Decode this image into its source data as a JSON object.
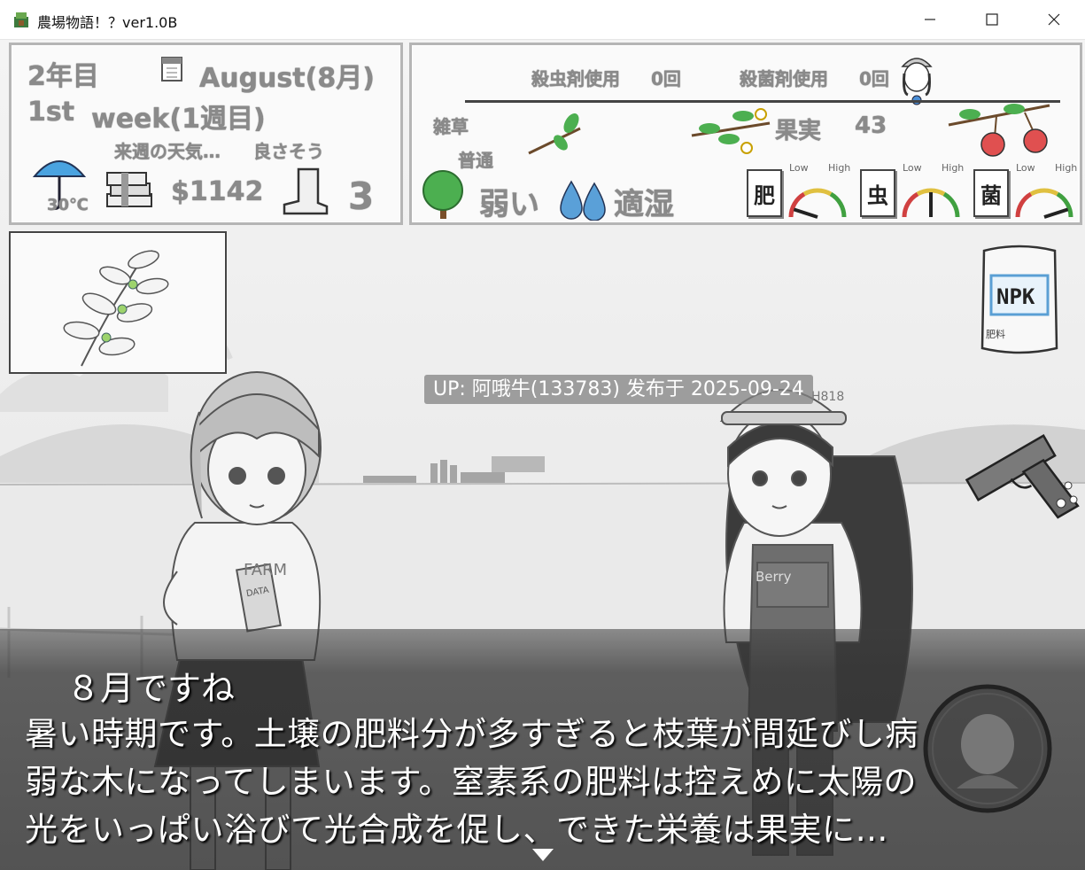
{
  "window": {
    "title": "農場物語！？ver1.0B",
    "minimize_glyph": "—",
    "maximize_glyph": "☐",
    "close_glyph": "✕"
  },
  "hud_left": {
    "year": "2年目",
    "month": "August(8月)",
    "week_ordinal": "1st",
    "week_label": "week(1週目)",
    "forecast_label": "来週の天気…",
    "forecast_value": "良さそう",
    "temperature": "30℃",
    "money": "$1142",
    "boots_count": "3"
  },
  "hud_right": {
    "insecticide_label": "殺虫剤使用",
    "insecticide_count": "0回",
    "fungicide_label": "殺菌剤使用",
    "fungicide_count": "0回",
    "weeds_label": "雑草",
    "weeds_value": "普通",
    "fruit_label": "果実",
    "fruit_count": "43",
    "tree_strength": "弱い",
    "moisture": "適湿",
    "gauges": [
      {
        "label": "肥",
        "low": "Low",
        "high": "High",
        "level": 0.1
      },
      {
        "label": "虫",
        "low": "Low",
        "high": "High",
        "level": 0.5
      },
      {
        "label": "菌",
        "low": "Low",
        "high": "High",
        "level": 0.9
      }
    ]
  },
  "items": {
    "fertilizer_bag_text": "NPK",
    "fertilizer_bag_sub": "肥料"
  },
  "characters": {
    "left_hoodie": "FARM",
    "left_book": "DATA",
    "right_cap": "H818",
    "right_overalls": "Berry"
  },
  "watermark": "UP: 阿哦牛(133783) 发布于 2025-09-24",
  "dialogue": {
    "speaker_line": "８月ですね",
    "lines": [
      "暑い時期です。土壌の肥料分が多すぎると枝葉が間延びし病",
      "弱な木になってしまいます。窒素系の肥料は控えめに太陽の",
      "光をいっぱい浴びて光合成を促し、できた栄養は果実に…"
    ]
  },
  "colors": {
    "panel_border": "#b5b5b5",
    "dialogue_bg": "#3c3c3c",
    "gauge_low": "#d04040",
    "gauge_mid": "#e0c040",
    "gauge_high": "#40a040",
    "umbrella": "#4aa3e0",
    "water": "#5aa0d8",
    "leaf": "#4caf50",
    "fruit": "#e05050"
  },
  "icons": [
    "app-icon",
    "calendar-icon",
    "umbrella-icon",
    "money-stack-icon",
    "boot-icon",
    "mascot-icon",
    "branch-icon",
    "flower-branch-icon",
    "cherry-icon",
    "tree-icon",
    "water-drop-icon",
    "gauge-icon",
    "fertilizer-bag-icon",
    "pistol-icon",
    "portrait-badge-icon",
    "next-arrow-icon"
  ]
}
